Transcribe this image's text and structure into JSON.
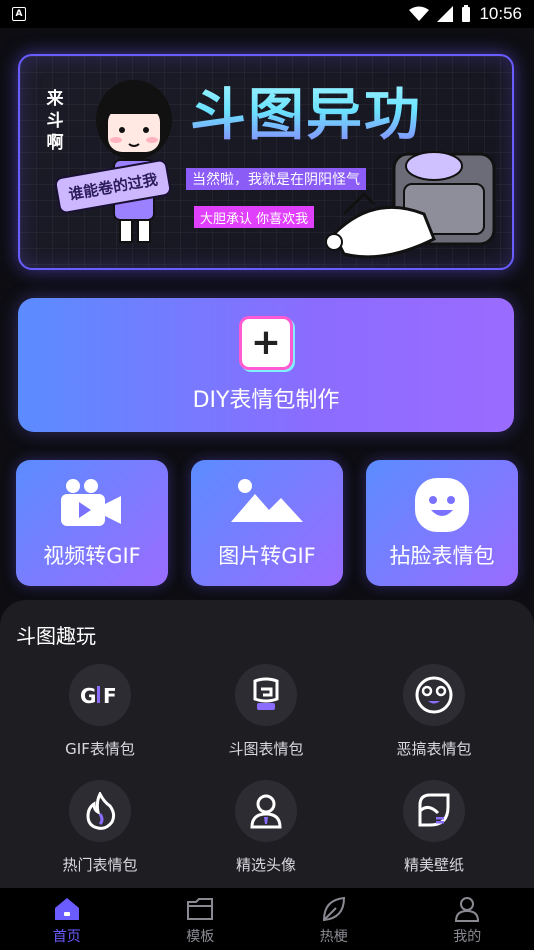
{
  "status_bar": {
    "time": "10:56",
    "left_badge": "A"
  },
  "banner": {
    "title": "斗图异功",
    "vertical_text": "来斗啊",
    "ribbon": "谁能卷的过我",
    "tag1": "当然啦，我就是在阴阳怪气",
    "tag2": "大胆承认 你喜欢我"
  },
  "diy": {
    "label": "DIY表情包制作"
  },
  "tools": [
    {
      "label": "视频转GIF",
      "icon": "video-camera-icon"
    },
    {
      "label": "图片转GIF",
      "icon": "image-mountain-icon"
    },
    {
      "label": "拈脸表情包",
      "icon": "smiley-face-icon"
    }
  ],
  "fun": {
    "title": "斗图趣玩",
    "items": [
      {
        "label": "GIF表情包",
        "icon": "gif-icon"
      },
      {
        "label": "斗图表情包",
        "icon": "fist-icon"
      },
      {
        "label": "恶搞表情包",
        "icon": "crazy-face-icon"
      },
      {
        "label": "热门表情包",
        "icon": "flame-icon"
      },
      {
        "label": "精选头像",
        "icon": "avatar-icon"
      },
      {
        "label": "精美壁纸",
        "icon": "wallpaper-icon"
      }
    ]
  },
  "tabs": [
    {
      "label": "首页",
      "icon": "home-icon",
      "active": true
    },
    {
      "label": "模板",
      "icon": "folder-icon",
      "active": false
    },
    {
      "label": "热梗",
      "icon": "leaf-icon",
      "active": false
    },
    {
      "label": "我的",
      "icon": "user-icon",
      "active": false
    }
  ],
  "colors": {
    "accent": "#6b5cff",
    "card_gradient_start": "#5b8cff",
    "card_gradient_end": "#9a6cff",
    "sheet_bg": "#1e1e22"
  }
}
